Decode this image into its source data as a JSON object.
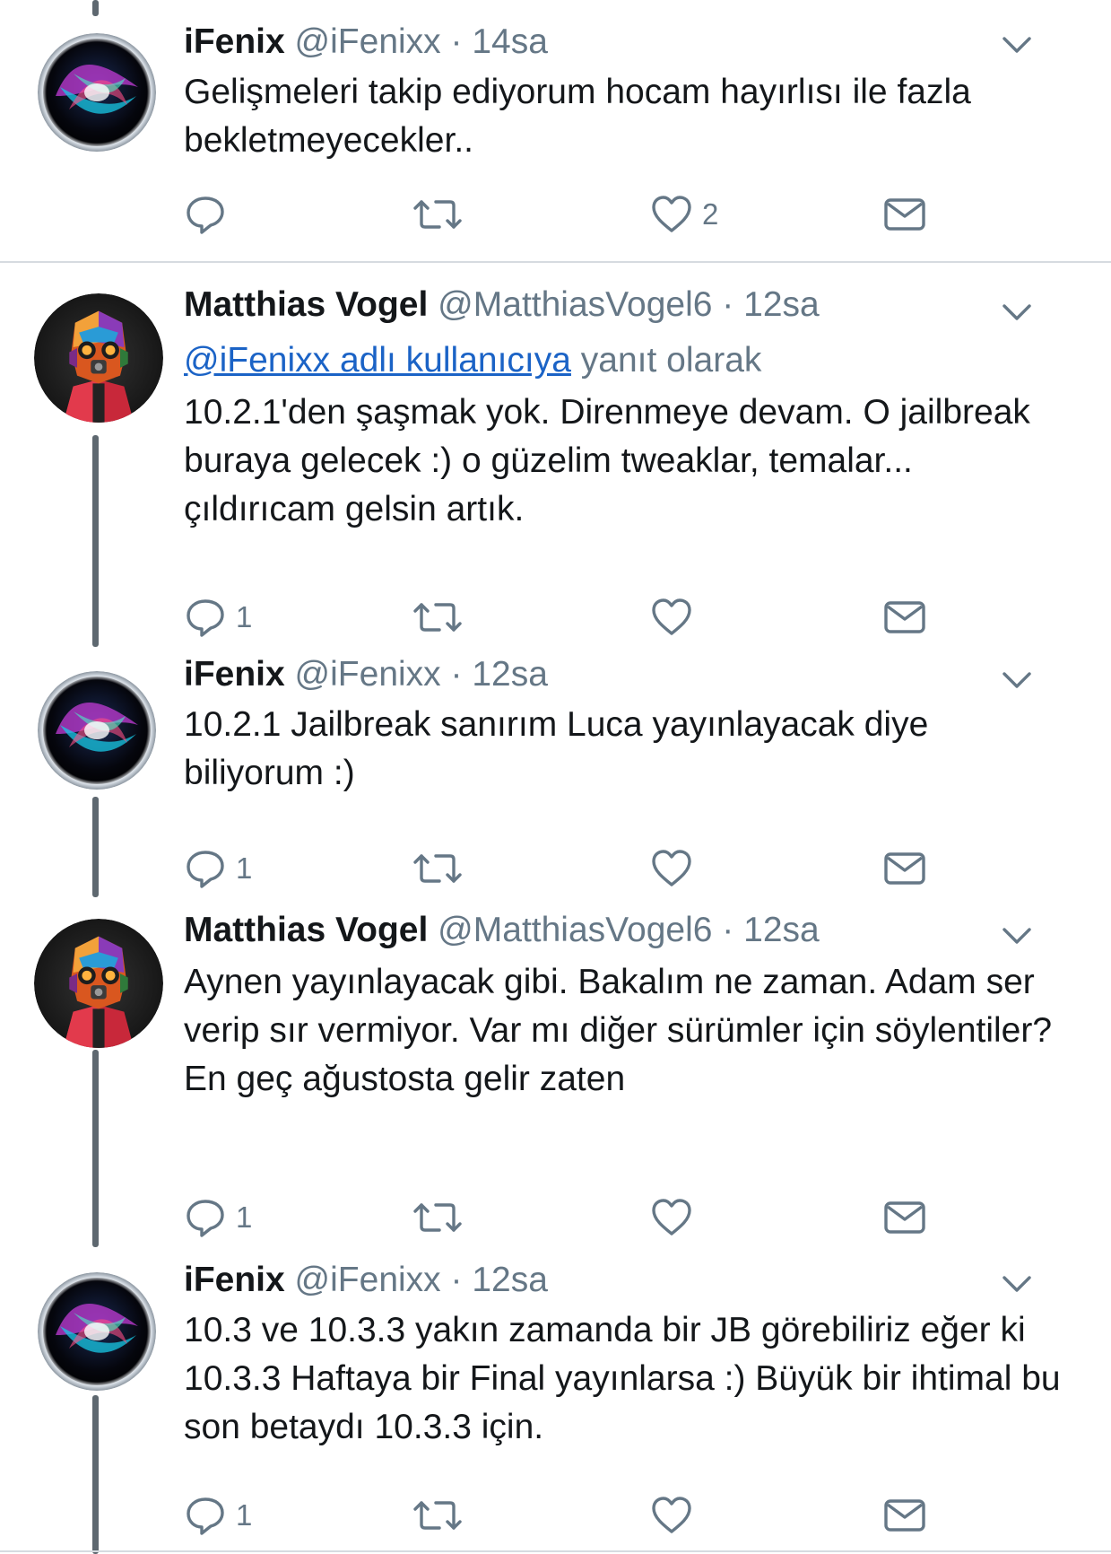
{
  "tweets": [
    {
      "display_name": "iFenix",
      "handle": "@iFenixx",
      "separator": "·",
      "time": "14sa",
      "reply_to_mention": "",
      "reply_to_suffix": "",
      "text": "Gelişmeleri takip ediyorum hocam hayırlısı ile fazla bekletmeyecekler..",
      "reply_count": "",
      "retweet_count": "",
      "like_count": "2"
    },
    {
      "display_name": "Matthias Vogel",
      "handle": "@MatthiasVogel6",
      "separator": "·",
      "time": "12sa",
      "reply_to_mention": "@iFenixx adlı kullanıcıya",
      "reply_to_suffix": "yanıt olarak",
      "text": "10.2.1'den şaşmak yok. Direnmeye devam. O jailbreak buraya gelecek :) o güzelim tweaklar, temalar... çıldırıcam gelsin artık.",
      "reply_count": "1",
      "retweet_count": "",
      "like_count": ""
    },
    {
      "display_name": "iFenix",
      "handle": "@iFenixx",
      "separator": "·",
      "time": "12sa",
      "reply_to_mention": "",
      "reply_to_suffix": "",
      "text": "10.2.1 Jailbreak sanırım Luca yayınlayacak diye biliyorum :)",
      "reply_count": "1",
      "retweet_count": "",
      "like_count": ""
    },
    {
      "display_name": "Matthias Vogel",
      "handle": "@MatthiasVogel6",
      "separator": "·",
      "time": "12sa",
      "reply_to_mention": "",
      "reply_to_suffix": "",
      "text": "Aynen yayınlayacak gibi. Bakalım ne zaman. Adam ser verip sır vermiyor. Var mı diğer sürümler için söylentiler? En geç ağustosta gelir zaten",
      "reply_count": "1",
      "retweet_count": "",
      "like_count": ""
    },
    {
      "display_name": "iFenix",
      "handle": "@iFenixx",
      "separator": "·",
      "time": "12sa",
      "reply_to_mention": "",
      "reply_to_suffix": "",
      "text": "10.3 ve 10.3.3 yakın zamanda bir JB görebiliriz eğer ki 10.3.3 Haftaya bir Final yayınlarsa :) Büyük bir ihtimal bu son betaydı 10.3.3 için.",
      "reply_count": "1",
      "retweet_count": "",
      "like_count": ""
    }
  ],
  "icons": {
    "avatar_ifenix": "siri-orb-avatar",
    "avatar_matthias": "star-lord-mask-avatar",
    "menu": "chevron-down-icon",
    "reply": "reply-bubble-icon",
    "retweet": "retweet-icon",
    "like": "heart-icon",
    "dm": "envelope-icon"
  },
  "colors": {
    "text": "#14171a",
    "muted": "#657786",
    "link": "#1b63c6",
    "thread_line": "#5e6870",
    "divider": "#d6dbe0"
  }
}
